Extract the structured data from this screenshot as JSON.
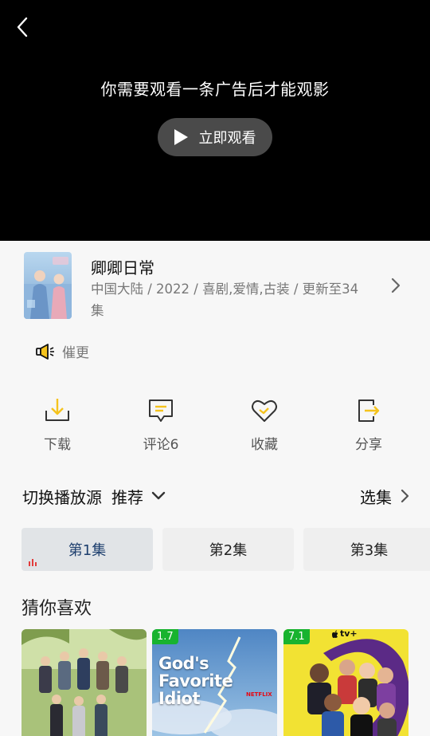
{
  "player": {
    "ad_message": "你需要观看一条广告后才能观影",
    "watch_button_label": "立即观看"
  },
  "show": {
    "title": "卿卿日常",
    "meta": "中国大陆 / 2022 / 喜剧,爱情,古装 / 更新至34集"
  },
  "urge": {
    "label": "催更"
  },
  "actions": [
    {
      "label": "下载",
      "icon": "download-icon"
    },
    {
      "label": "评论6",
      "icon": "comment-icon"
    },
    {
      "label": "收藏",
      "icon": "heart-icon"
    },
    {
      "label": "分享",
      "icon": "share-icon"
    }
  ],
  "source": {
    "label": "切换播放源",
    "value": "推荐",
    "select_episodes_label": "选集"
  },
  "episodes": [
    {
      "label": "第1集",
      "active": true
    },
    {
      "label": "第2集",
      "active": false
    },
    {
      "label": "第3集",
      "active": false
    }
  ],
  "recommend": {
    "title": "猜你喜欢",
    "items": [
      {
        "score": ""
      },
      {
        "score": "1.7",
        "poster_text": "God's Favorite Idiot",
        "badge": "NETFLIX"
      },
      {
        "score": "7.1",
        "badge": "tv+"
      }
    ]
  },
  "colors": {
    "accent_yellow": "#f5c31d",
    "score_green": "#18b32f",
    "active_episode_text": "#1e3f6e",
    "playing_red": "#e23c3c"
  }
}
